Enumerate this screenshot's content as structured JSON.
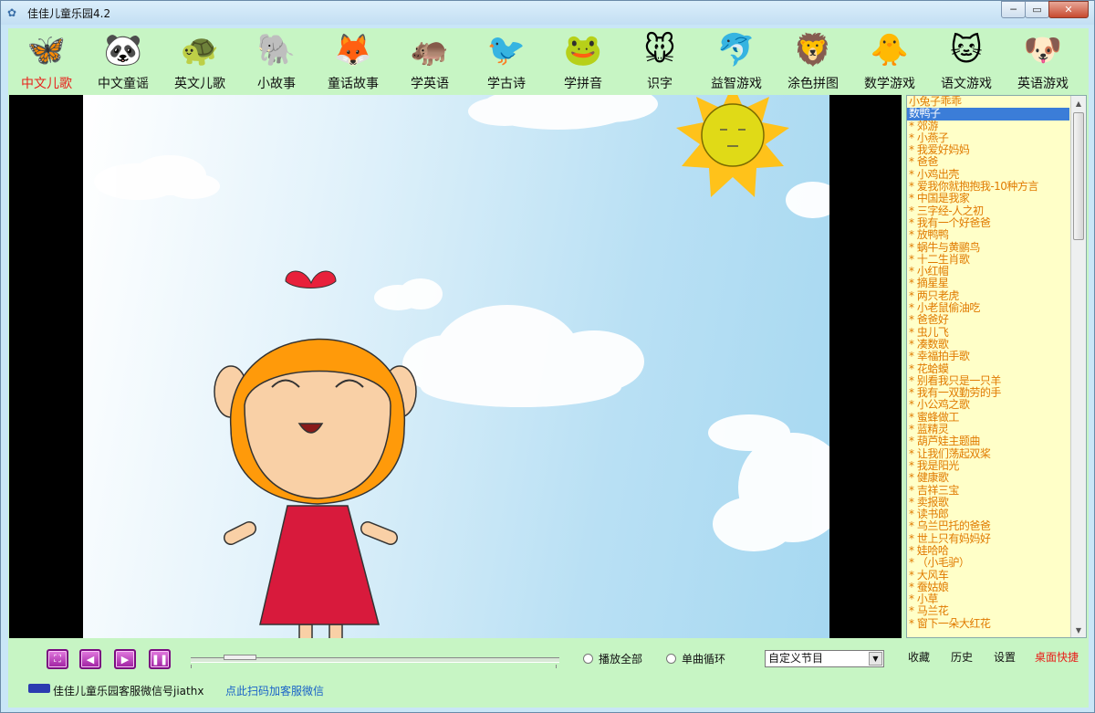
{
  "window": {
    "title": "佳佳儿童乐园4.2",
    "minimize": "─",
    "maximize": "▭",
    "close": "✕"
  },
  "toolbar": [
    {
      "label": "中文儿歌",
      "icon": "butterfly-icon",
      "glyph": "🦋",
      "active": true
    },
    {
      "label": "中文童谣",
      "icon": "panda-icon",
      "glyph": "🐼"
    },
    {
      "label": "英文儿歌",
      "icon": "turtle-icon",
      "glyph": "🐢"
    },
    {
      "label": "小故事",
      "icon": "elephant-icon",
      "glyph": "🐘"
    },
    {
      "label": "童话故事",
      "icon": "fox-icon",
      "glyph": "🦊"
    },
    {
      "label": "学英语",
      "icon": "hippo-icon",
      "glyph": "🦛"
    },
    {
      "label": "学古诗",
      "icon": "toucan-icon",
      "glyph": "🐦"
    },
    {
      "label": "学拼音",
      "icon": "frog-icon",
      "glyph": "🐸"
    },
    {
      "label": "识字",
      "icon": "mouse-icon",
      "glyph": "🐭"
    },
    {
      "label": "益智游戏",
      "icon": "dolphin-icon",
      "glyph": "🐬"
    },
    {
      "label": "涂色拼图",
      "icon": "lion-icon",
      "glyph": "🦁"
    },
    {
      "label": "数学游戏",
      "icon": "duck-icon",
      "glyph": "🐥"
    },
    {
      "label": "语文游戏",
      "icon": "cat-icon",
      "glyph": "🐱"
    },
    {
      "label": "英语游戏",
      "icon": "dog-icon",
      "glyph": "🐶"
    }
  ],
  "playlist": {
    "selected_index": 1,
    "items": [
      "小兔子乖乖",
      "数鸭子",
      "* 郊游",
      "* 小燕子",
      "* 我爱好妈妈",
      "* 爸爸",
      "* 小鸡出壳",
      "* 爱我你就抱抱我-10种方言",
      "* 中国是我家",
      "* 三字经-人之初",
      "* 我有一个好爸爸",
      "* 放鸭鸭",
      "* 蜗牛与黄鹂鸟",
      "* 十二生肖歌",
      "* 小红帽",
      "* 摘星星",
      "* 两只老虎",
      "* 小老鼠偷油吃",
      "* 爸爸好",
      "* 虫儿飞",
      "* 凑数歌",
      "* 幸福拍手歌",
      "* 花蛤蟆",
      "* 别看我只是一只羊",
      "* 我有一双勤劳的手",
      "* 小公鸡之歌",
      "* 蜜蜂做工",
      "* 蓝精灵",
      "* 葫芦娃主题曲",
      "* 让我们荡起双桨",
      "* 我是阳光",
      "* 健康歌",
      "* 吉祥三宝",
      "* 卖报歌",
      "* 读书郎",
      "* 乌兰巴托的爸爸",
      "* 世上只有妈妈好",
      "* 娃哈哈",
      "* （小毛驴）",
      "* 大风车",
      "* 蚕姑娘",
      "* 小草",
      "* 马兰花",
      "* 窗下一朵大红花"
    ],
    "scroll_up": "▲",
    "scroll_down": "▼"
  },
  "controls": {
    "fullscreen_glyph": "⛶",
    "prev_glyph": "◀",
    "play_glyph": "▶",
    "pause_glyph": "❚❚",
    "play_all_label": "播放全部",
    "single_loop_label": "单曲循环",
    "program_select_value": "自定义节目",
    "select_arrow": "▼",
    "favorites_label": "收藏",
    "history_label": "历史",
    "settings_label": "设置",
    "desktop_shortcut_label": "桌面快捷",
    "progress": 0.09
  },
  "footer": {
    "service_text": "佳佳儿童乐园客服微信号jiathx",
    "scan_link": "点此扫码加客服微信"
  },
  "colors": {
    "client_bg": "#c7f5c4",
    "active_label": "#e8211b",
    "playlist_text": "#e07a00",
    "playlist_bg": "#ffffc8",
    "select_highlight": "#3b7dd8",
    "link_blue": "#1a63c8"
  }
}
